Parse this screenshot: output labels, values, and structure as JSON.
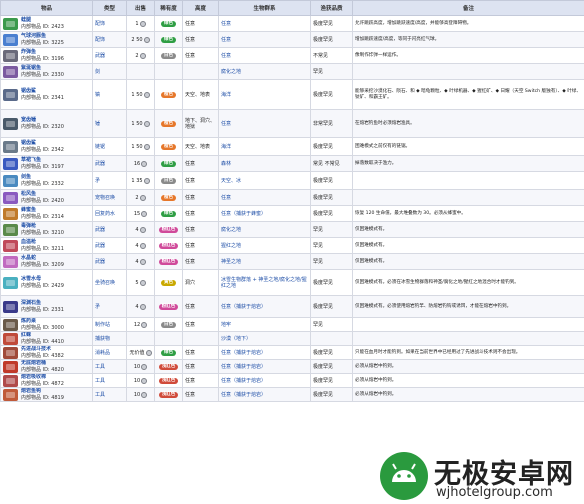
{
  "headers": {
    "item": "物品",
    "type": "类型",
    "sell": "出售",
    "rarity": "稀有度",
    "height": "高度",
    "biome": "生物群系",
    "quest": "渔获品质",
    "notes": "备注"
  },
  "rows": [
    {
      "name": "蛙腿",
      "id": "内部物品 ID: 2423",
      "type": "配饰",
      "sell": "1",
      "rarity": "绿色",
      "rarity_color": "#2f9e44",
      "height": "任意",
      "biome": "任意",
      "quest": "极度罕见",
      "notes": "允许跳跃高度，增加跳跃速度/高度，并能够高登障碍物。",
      "icon": "#3b9a4c"
    },
    {
      "name": "气球河豚鱼",
      "id": "内部物品 ID: 3225",
      "type": "配饰",
      "sell": "2 50",
      "rarity": "绿色",
      "rarity_color": "#2f9e44",
      "height": "任意",
      "biome": "任意",
      "quest": "极度罕见",
      "notes": "增加跳跃速度/高度，等同于闪亮红气球。",
      "icon": "#4a7fd0"
    },
    {
      "name": "炸弹鱼",
      "id": "内部物品 ID: 3196",
      "type": "武器",
      "sell": "2",
      "rarity": "白色",
      "rarity_color": "#8a8a8a",
      "height": "任意",
      "biome": "任意",
      "quest": "不常见",
      "notes": "像制作炸弹一样运作。",
      "icon": "#6a6a7a"
    },
    {
      "name": "紫涎锯鱼",
      "id": "内部物品 ID: 2330",
      "type": "剑",
      "sell": "",
      "rarity": "",
      "rarity_color": "#ffffff",
      "height": "",
      "biome": "腐化之地",
      "quest": "罕见",
      "notes": "",
      "icon": "#7b5aa0"
    },
    {
      "name": "锯齿鲨",
      "id": "内部物品 ID: 2341",
      "type": "镐",
      "sell": "1 50",
      "rarity": "橙色",
      "rarity_color": "#e6772a",
      "height": "天空、地表",
      "biome": "海洋",
      "quest": "极度罕见",
      "notes": "能够采挖沙漠化石、陨石、和 ◆ 暗龟颗粒、◆ 叶绿机器、◆ 猩红矿、◆ 日耀（天空 Switch 版独有）、◆ 叶绿、钛矿、和霸王矿。",
      "icon": "#5a6a8a"
    },
    {
      "name": "宽齿锤",
      "id": "内部物品 ID: 2320",
      "type": "锤",
      "sell": "1 50",
      "rarity": "橙色",
      "rarity_color": "#e6772a",
      "height": "地下、洞穴、地狱",
      "biome": "任意",
      "quest": "非常罕见",
      "notes": "在熔岩钓鱼时必须熔岩渔具。",
      "icon": "#4a5a6a"
    },
    {
      "name": "锯齿鲨",
      "id": "内部物品 ID: 2342",
      "type": "链锯",
      "sell": "1 50",
      "rarity": "橙色",
      "rarity_color": "#e6772a",
      "height": "天空、地表",
      "biome": "海洋",
      "quest": "极度罕见",
      "notes": "困难模式之前仅有的链锯。",
      "icon": "#6a7a8a"
    },
    {
      "name": "草裙飞鱼",
      "id": "内部物品 ID: 3197",
      "type": "武器",
      "sell": "16",
      "rarity": "绿色",
      "rarity_color": "#2f9e44",
      "height": "任意",
      "biome": "森林",
      "quest": "常见 不常见",
      "notes": "掉落数取决于渔力。",
      "icon": "#3a5ac0"
    },
    {
      "name": "剑鱼",
      "id": "内部物品 ID: 2332",
      "type": "矛",
      "sell": "1 35",
      "rarity": "白色",
      "rarity_color": "#8a8a8a",
      "height": "任意",
      "biome": "天空、冰",
      "quest": "极度罕见",
      "notes": "",
      "icon": "#4a8ac0"
    },
    {
      "name": "松风鱼",
      "id": "内部物品 ID: 2420",
      "type": "宠物召唤",
      "sell": "2",
      "rarity": "橙色",
      "rarity_color": "#e6772a",
      "height": "任意",
      "biome": "任意",
      "quest": "极度罕见",
      "notes": "",
      "icon": "#8a5ac0"
    },
    {
      "name": "蜂蜜鱼",
      "id": "内部物品 ID: 2314",
      "type": "回复药水",
      "sell": "15",
      "rarity": "绿色",
      "rarity_color": "#2f9e44",
      "height": "任意",
      "biome": "任意（捕获于蜂蜜）",
      "quest": "极度罕见",
      "notes": "恢复 120 生命值，最大堆叠数为 30。必须从蜂蜜中。",
      "icon": "#c07a2a"
    },
    {
      "name": "毒弹枪",
      "id": "内部物品 ID: 3210",
      "type": "武器",
      "sell": "4",
      "rarity": "粉红色",
      "rarity_color": "#d04a9a",
      "height": "任意",
      "biome": "腐化之地",
      "quest": "罕见",
      "notes": "仅困难模式有。",
      "icon": "#5a8a4a"
    },
    {
      "name": "血溢枪",
      "id": "内部物品 ID: 3211",
      "type": "武器",
      "sell": "4",
      "rarity": "粉红色",
      "rarity_color": "#d04a9a",
      "height": "任意",
      "biome": "猩红之地",
      "quest": "罕见",
      "notes": "仅困难模式有。",
      "icon": "#c04a5a"
    },
    {
      "name": "水晶蛇",
      "id": "内部物品 ID: 3209",
      "type": "武器",
      "sell": "4",
      "rarity": "粉红色",
      "rarity_color": "#d04a9a",
      "height": "任意",
      "biome": "神圣之地",
      "quest": "罕见",
      "notes": "仅困难模式有。",
      "icon": "#c06ac0"
    },
    {
      "name": "冰雪水母",
      "id": "内部物品 ID: 2429",
      "type": "坐骑召唤",
      "sell": "5",
      "rarity": "黄色",
      "rarity_color": "#c9a800",
      "height": "洞穴",
      "biome": "冰雪生物群落 + 神圣之地/腐化之地/猩红之地",
      "quest": "极度罕见",
      "notes": "仅困难模式有。必须在冰雪生物群落和神圣/腐化之地/猩红之地混合时才能钓到。",
      "icon": "#4ab0c0"
    },
    {
      "name": "深渊石鱼",
      "id": "内部物品 ID: 2331",
      "type": "矛",
      "sell": "4",
      "rarity": "粉红色",
      "rarity_color": "#d04a9a",
      "height": "任意",
      "biome": "任意（捕获于熔岩）",
      "quest": "极度罕见",
      "notes": "仅困难模式有。必须使用熔岩钓竿、防熔岩钓钩或诱饵，才能在熔岩中钓到。",
      "icon": "#3a3a8a"
    },
    {
      "name": "炼药桌",
      "id": "内部物品 ID: 3000",
      "type": "制作站",
      "sell": "12",
      "rarity": "白色",
      "rarity_color": "#8a8a8a",
      "height": "任意",
      "biome": "地牢",
      "quest": "罕见",
      "notes": "",
      "icon": "#6a5a4a"
    },
    {
      "name": "红蝾",
      "id": "内部物品 ID: 4410",
      "type": "捕获物",
      "sell": "",
      "rarity": "",
      "rarity_color": "#ffffff",
      "height": "",
      "biome": "沙漠（地下）",
      "quest": "",
      "notes": "",
      "icon": "#c04a3a"
    },
    {
      "name": "先进战斗技术",
      "id": "内部物品 ID: 4382",
      "type": "消耗品",
      "sell": "无价值",
      "rarity": "绿色",
      "rarity_color": "#2f9e44",
      "height": "任意",
      "biome": "任意（捕获于熔岩）",
      "quest": "极度罕见",
      "notes": "只能在血月时才能钓到。如果在当前世界中已经用过了先进战斗技术则不会出现。",
      "icon": "#a04a3a"
    },
    {
      "name": "无底熔岩桶",
      "id": "内部物品 ID: 4820",
      "type": "工具",
      "sell": "10",
      "rarity": "浅红色",
      "rarity_color": "#d04a3a",
      "height": "任意",
      "biome": "任意（捕获于熔岩）",
      "quest": "极度罕见",
      "notes": "必须从熔岩中钓到。",
      "icon": "#c03a2a"
    },
    {
      "name": "熔岩吸收棉",
      "id": "内部物品 ID: 4872",
      "type": "工具",
      "sell": "10",
      "rarity": "浅红色",
      "rarity_color": "#d04a3a",
      "height": "任意",
      "biome": "任意（捕获于熔岩）",
      "quest": "极度罕见",
      "notes": "必须从熔岩中钓到。",
      "icon": "#b04a4a"
    },
    {
      "name": "熔岩鱼钩",
      "id": "内部物品 ID: 4819",
      "type": "工具",
      "sell": "10",
      "rarity": "浅红色",
      "rarity_color": "#d04a3a",
      "height": "任意",
      "biome": "任意（捕获于熔岩）",
      "quest": "极度罕见",
      "notes": "必须从熔岩中钓到。",
      "icon": "#c05a3a"
    }
  ],
  "watermark": {
    "title": "无极安卓网",
    "url": "wjhotelgroup.com"
  }
}
